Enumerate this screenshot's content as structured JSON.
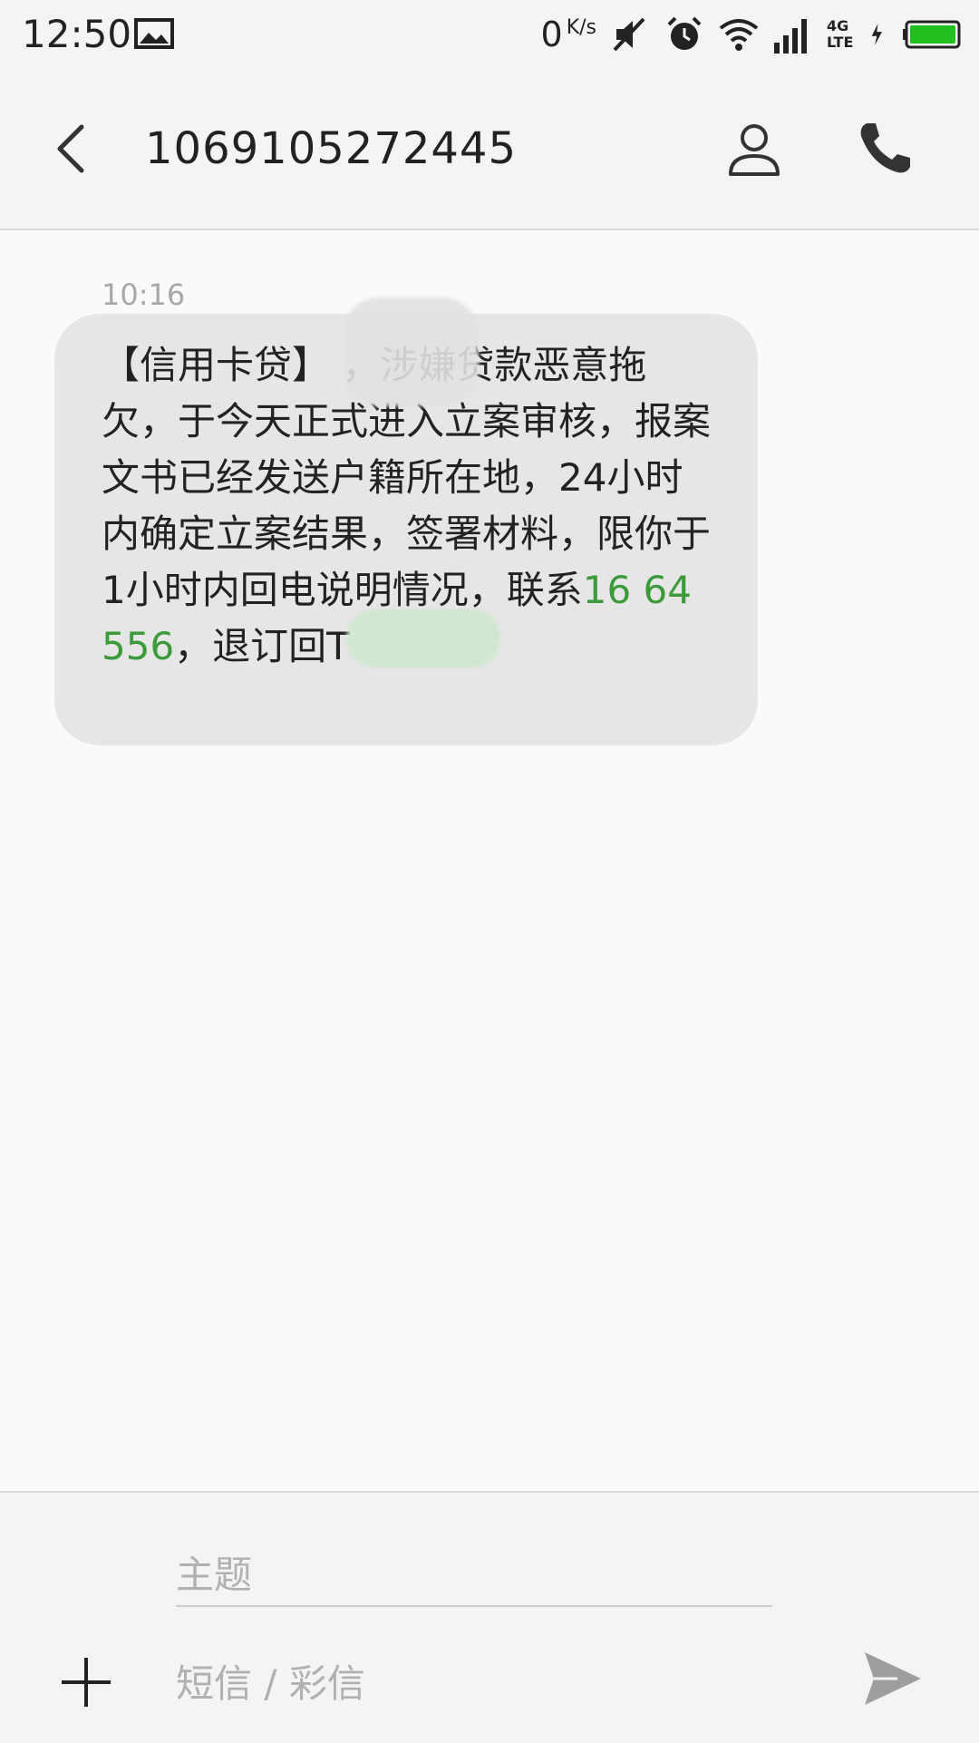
{
  "status_bar": {
    "time": "12:50",
    "net_speed_value": "0",
    "net_speed_unit": "K/s",
    "network_type": "4G LTE",
    "icons": [
      "gallery-icon",
      "mute-icon",
      "alarm-icon",
      "wifi-icon",
      "signal-icon",
      "charging-icon",
      "battery-icon"
    ],
    "battery_color": "#22c01e"
  },
  "header": {
    "title": "1069105272445",
    "icons": [
      "back-icon",
      "contact-icon",
      "phone-icon"
    ]
  },
  "messages": [
    {
      "time": "10:16",
      "text_before_link": "【信用卡贷】       ，涉嫌贷款恶意拖欠，于今天正式进入立案审核，报案文书已经发送户籍所在地，24小时内确定立案结果，签署材料，限你于1小时内回电说明情况，联系",
      "link_text": "16   64556",
      "text_after_link": "，退订回T"
    }
  ],
  "composer": {
    "subject_placeholder": "主题",
    "body_placeholder": "短信 / 彩信",
    "icons": [
      "add-icon",
      "send-icon"
    ]
  },
  "colors": {
    "link": "#3b9b3b",
    "bubble": "#e6e6e6",
    "background": "#fafafa"
  }
}
